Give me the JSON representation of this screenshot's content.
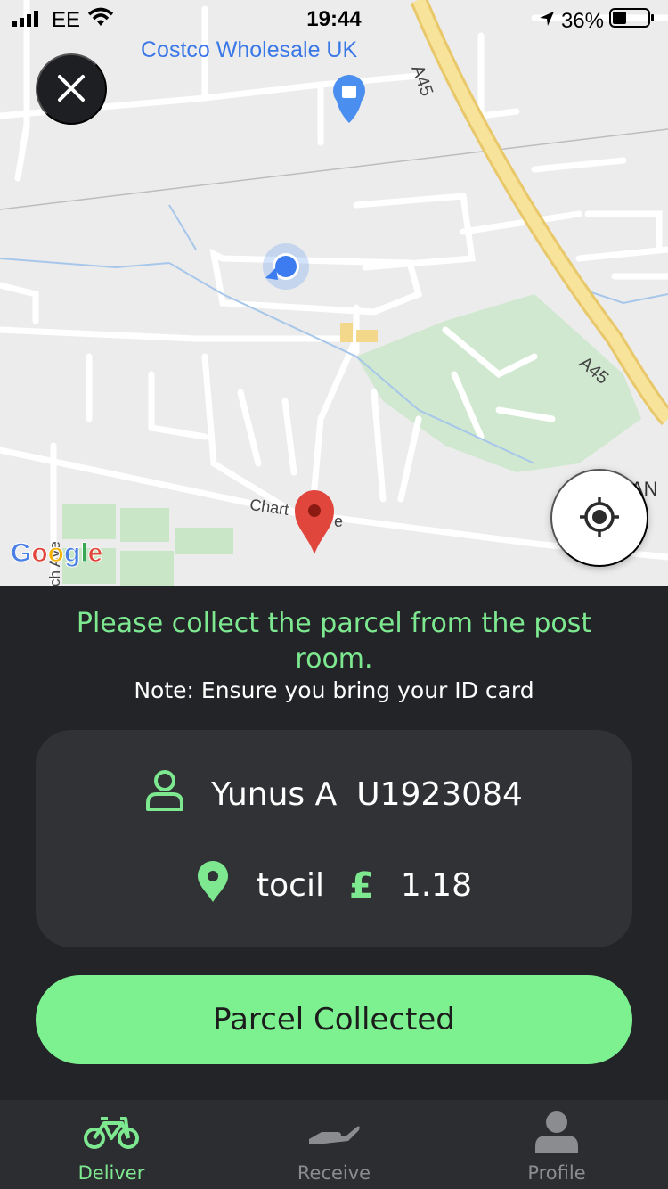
{
  "status_bar": {
    "carrier": "EE",
    "time": "19:44",
    "battery": "36%"
  },
  "map": {
    "poi_label": "Costco Wholesale UK",
    "road_a45_top": "A45",
    "road_a45_right": "A45",
    "street_label_left": "Chart",
    "street_label_right": "e",
    "ave_label": "ch Ave",
    "edge_label": "AN",
    "provider": "Google"
  },
  "instruction": {
    "message": "Please collect the parcel from the post room.",
    "note": "Note: Ensure you bring your ID card"
  },
  "details": {
    "name": "Yunus A",
    "user_id": "U1923084",
    "location": "tocil",
    "currency_symbol": "£",
    "amount": "1.18"
  },
  "action": {
    "button_label": "Parcel Collected"
  },
  "tabs": [
    {
      "label": "Deliver",
      "icon": "bicycle-icon",
      "active": true
    },
    {
      "label": "Receive",
      "icon": "hand-icon",
      "active": false
    },
    {
      "label": "Profile",
      "icon": "person-icon",
      "active": false
    }
  ],
  "colors": {
    "accent": "#7de88f",
    "button": "#7df190",
    "panel": "#222428",
    "card": "#313236",
    "pin": "#e0463b"
  }
}
